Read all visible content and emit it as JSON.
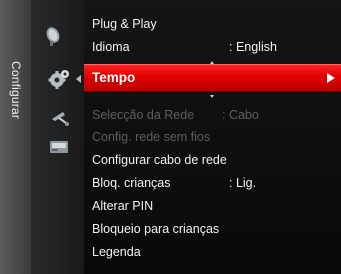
{
  "side_tab": {
    "label": "Configurar"
  },
  "icons": [
    {
      "name": "satellite-dish-icon"
    },
    {
      "name": "gears-icon"
    },
    {
      "name": "antenna-icon"
    },
    {
      "name": "input-box-icon"
    }
  ],
  "menu": {
    "items": [
      {
        "label": "Plug & Play",
        "value": "",
        "state": "normal"
      },
      {
        "label": "Idioma",
        "value": ": English",
        "state": "normal"
      },
      {
        "label": "Tempo",
        "value": "",
        "state": "selected"
      },
      {
        "label": "Selecção da Rede",
        "value": ": Cabo",
        "state": "disabled"
      },
      {
        "label": "Config. rede sem fios",
        "value": "",
        "state": "disabled"
      },
      {
        "label": "Configurar cabo de rede",
        "value": "",
        "state": "normal"
      },
      {
        "label": "Bloq. crianças",
        "value": ": Lig.",
        "state": "normal"
      },
      {
        "label": "Alterar PIN",
        "value": "",
        "state": "normal"
      },
      {
        "label": "Bloqueio para crianças",
        "value": "",
        "state": "normal"
      },
      {
        "label": "Legenda",
        "value": "",
        "state": "normal"
      }
    ]
  },
  "colors": {
    "highlight": "#e00000",
    "disabled_text": "#5e5e5e",
    "text": "#f2f2f2"
  }
}
